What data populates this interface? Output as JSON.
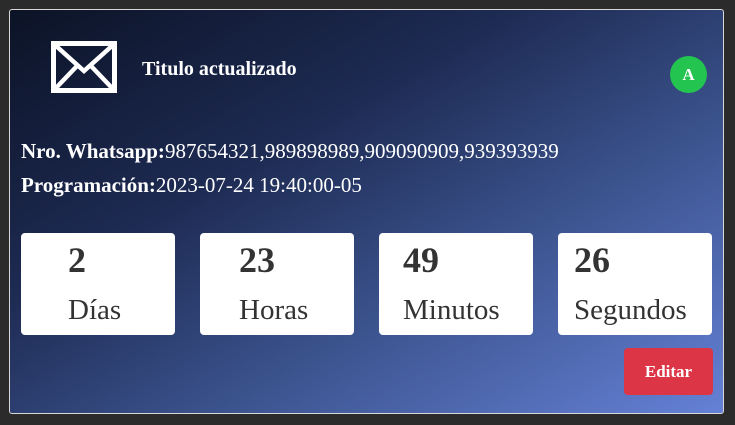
{
  "card": {
    "icon": "envelope-icon",
    "title": "Titulo actualizado",
    "avatar_letter": "A",
    "avatar_color": "#23c450"
  },
  "info": {
    "whatsapp_label": "Nro. Whatsapp:",
    "whatsapp_value": "987654321,989898989,909090909,939393939",
    "schedule_label": "Programación:",
    "schedule_value": "2023-07-24 19:40:00-05"
  },
  "countdown": [
    {
      "value": "2",
      "unit": "Días"
    },
    {
      "value": "23",
      "unit": "Horas"
    },
    {
      "value": "49",
      "unit": "Minutos"
    },
    {
      "value": "26",
      "unit": "Segundos"
    }
  ],
  "actions": {
    "edit_label": "Editar",
    "edit_color": "#dc3545"
  }
}
